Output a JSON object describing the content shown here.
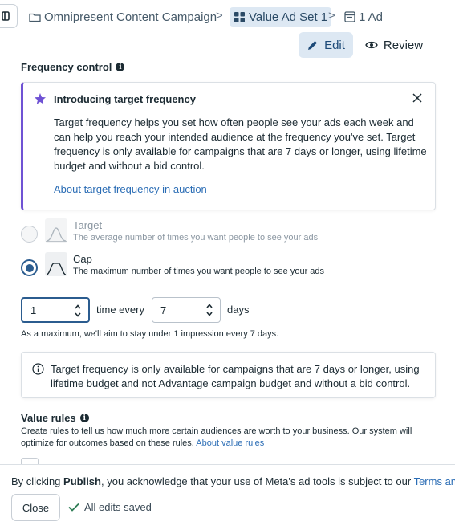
{
  "breadcrumb": {
    "campaign": "Omnipresent Content Campaign",
    "ad_set": "Value Ad Set 1",
    "ad": "1 Ad",
    "separator": ">"
  },
  "actions": {
    "edit_label": "Edit",
    "review_label": "Review"
  },
  "frequency": {
    "section_title": "Frequency control",
    "intro": {
      "title": "Introducing target frequency",
      "body": "Target frequency helps you set how often people see your ads each week and can help you reach your intended audience at the frequency you've set. Target frequency is only available for campaigns that are 7 days or longer, using lifetime budget and without a bid control.",
      "link": "About target frequency in auction"
    },
    "options": [
      {
        "label": "Target",
        "description": "The average number of times you want people to see your ads",
        "selected": false,
        "disabled": true
      },
      {
        "label": "Cap",
        "description": "The maximum number of times you want people to see your ads",
        "selected": true,
        "disabled": false
      }
    ],
    "cap_value": "1",
    "time_every_label": "time every",
    "days_value": "7",
    "days_label": "days",
    "max_note": "As a maximum, we'll aim to stay under 1 impression every 7 days.",
    "notice": "Target frequency is only available for campaigns that are 7 days or longer, using lifetime budget and not Advantage campaign budget and without a bid control."
  },
  "value_rules": {
    "title": "Value rules",
    "description": "Create rules to tell us how much more certain audiences are worth to your business. Our system will optimize for outcomes based on these rules.",
    "link": "About value rules"
  },
  "footer": {
    "legal_prefix": "By clicking ",
    "legal_bold": "Publish",
    "legal_middle": ", you acknowledge that your use of Meta's ad tools is subject to our ",
    "legal_link": "Terms and",
    "close_label": "Close",
    "saved_status": "All edits saved"
  },
  "colors": {
    "accent": "#2b5c8f",
    "link": "#2b6db5",
    "purple": "#6f52d4",
    "success": "#2e7d55"
  }
}
